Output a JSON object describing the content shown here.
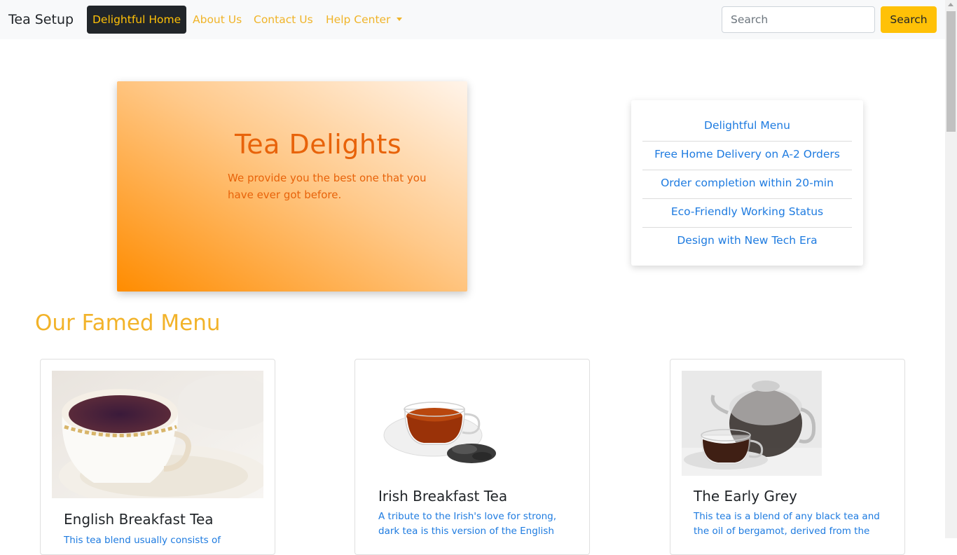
{
  "navbar": {
    "brand": "Tea Setup",
    "links": [
      {
        "label": "Delightful Home"
      },
      {
        "label": "About Us"
      },
      {
        "label": "Contact Us"
      },
      {
        "label": "Help Center"
      }
    ],
    "search_placeholder": "Search",
    "search_button": "Search"
  },
  "hero": {
    "title": "Tea Delights",
    "subtitle": "We provide you the best one that you have ever got before."
  },
  "features": {
    "items": [
      "Delightful Menu",
      "Free Home Delivery on A-2 Orders",
      "Order completion within 20-min",
      "Eco-Friendly Working Status",
      "Design with New Tech Era"
    ]
  },
  "menu": {
    "title": "Our Famed Menu",
    "cards": [
      {
        "title": "English Breakfast Tea",
        "text": "This tea blend usually consists of"
      },
      {
        "title": "Irish Breakfast Tea",
        "text": "A tribute to the Irish's love for strong, dark tea is this version of the English"
      },
      {
        "title": "The Early Grey",
        "text": "This tea is a blend of any black tea and the oil of bergamot, derived from the"
      }
    ]
  },
  "colors": {
    "accent": "#ffc107",
    "link": "#1e7be0",
    "hero_text": "#e8630a",
    "nav_link": "#f0b429"
  }
}
